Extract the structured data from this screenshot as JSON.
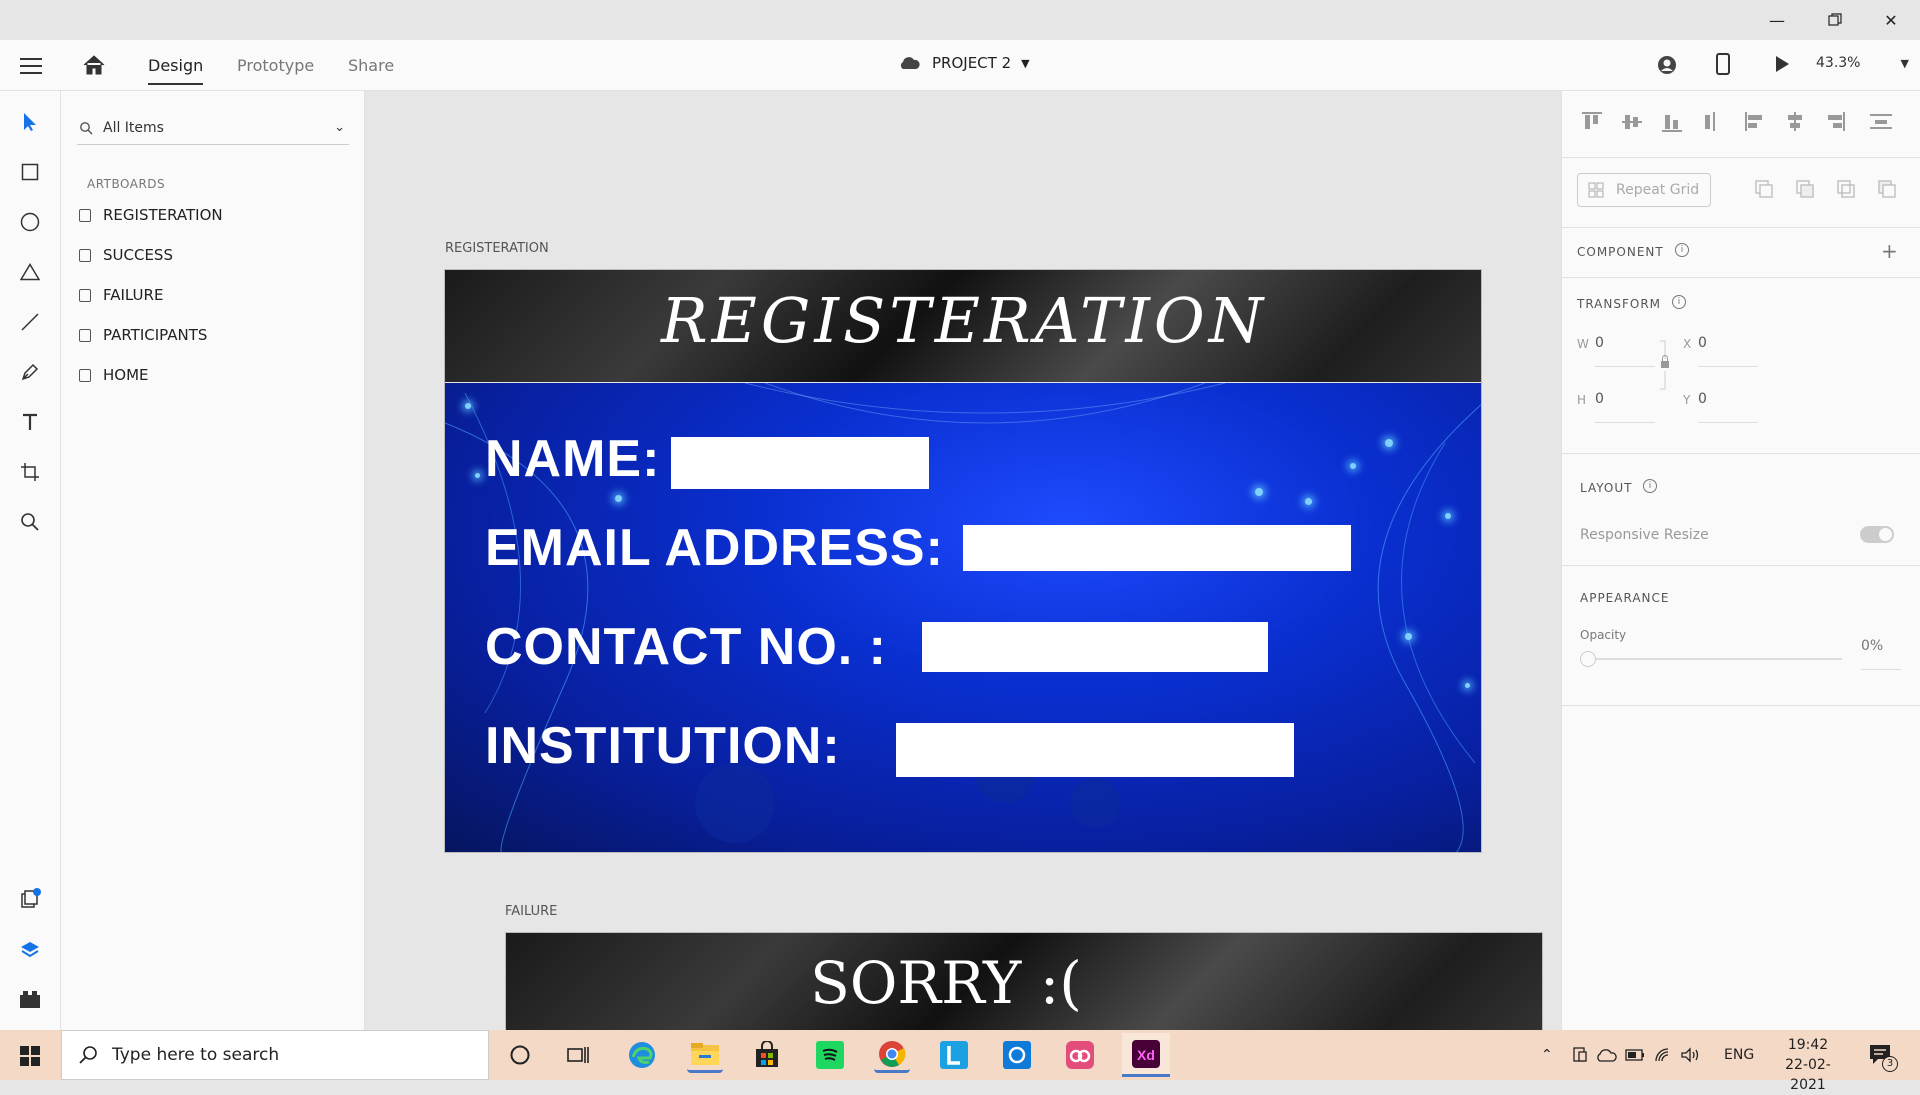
{
  "header": {
    "tabs": [
      {
        "label": "Design",
        "active": true
      },
      {
        "label": "Prototype",
        "active": false
      },
      {
        "label": "Share",
        "active": false
      }
    ],
    "project_name": "PROJECT 2",
    "zoom": "43.3%"
  },
  "layers": {
    "search_label": "All Items",
    "section_label": "ARTBOARDS",
    "artboards": [
      "REGISTERATION",
      "SUCCESS",
      "FAILURE",
      "PARTICIPANTS",
      "HOME"
    ]
  },
  "canvas": {
    "registration_label": "REGISTERATION",
    "registration_title": "REGISTERATION",
    "form_labels": [
      "NAME:",
      "EMAIL ADDRESS:",
      "CONTACT NO. :",
      "INSTITUTION:"
    ],
    "failure_label": "FAILURE",
    "failure_title": "SORRY :("
  },
  "props": {
    "repeat_grid": "Repeat Grid",
    "component_title": "COMPONENT",
    "transform_title": "TRANSFORM",
    "w_label": "W",
    "w_value": "0",
    "x_label": "X",
    "x_value": "0",
    "h_label": "H",
    "h_value": "0",
    "y_label": "Y",
    "y_value": "0",
    "layout_title": "LAYOUT",
    "responsive_resize": "Responsive Resize",
    "appearance_title": "APPEARANCE",
    "opacity_label": "Opacity",
    "opacity_value": "0%"
  },
  "taskbar": {
    "search_placeholder": "Type here to search",
    "language": "ENG",
    "time": "19:42",
    "date": "22-02-2021",
    "notification_count": "3"
  },
  "colors": {
    "accent": "#1473e6",
    "xd_brand": "#470137",
    "xd_text": "#ff61f6"
  },
  "icons": {
    "toolbar": [
      "select-icon",
      "rectangle-icon",
      "ellipse-icon",
      "polygon-icon",
      "line-icon",
      "pen-icon",
      "text-icon",
      "artboard-icon",
      "zoom-icon"
    ],
    "toolbar_bottom": [
      "assets-icon",
      "layers-icon",
      "plugins-icon"
    ]
  }
}
